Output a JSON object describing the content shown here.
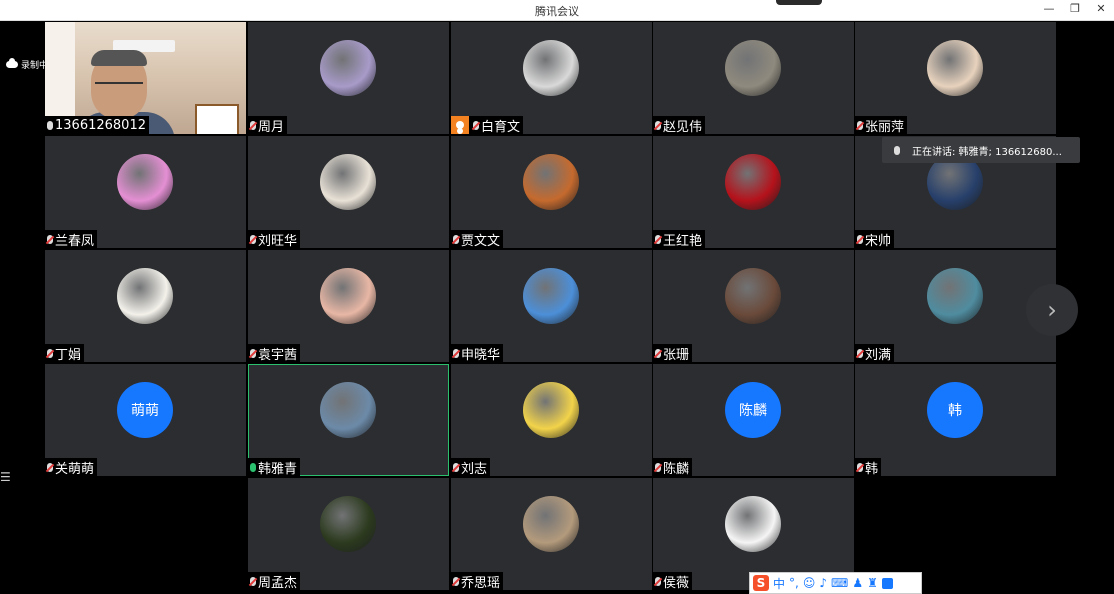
{
  "window": {
    "title": "腾讯会议",
    "controls": {
      "minimize": "—",
      "restore": "❐",
      "close": "✕"
    }
  },
  "recording": {
    "label": "录制中"
  },
  "speaking_tooltip": "正在讲话: 韩雅青; 136612680...",
  "participants": [
    {
      "name": "13661268012",
      "mic": "on",
      "avatar": "camera"
    },
    {
      "name": "周月",
      "mic": "muted",
      "avatar": "photo",
      "color": "#a89bc9"
    },
    {
      "name": "白育文",
      "mic": "muted",
      "avatar": "photo",
      "color": "#d9d9d9",
      "host": true
    },
    {
      "name": "赵见伟",
      "mic": "muted",
      "avatar": "photo",
      "color": "#8f8a7e"
    },
    {
      "name": "张丽萍",
      "mic": "muted",
      "avatar": "photo",
      "color": "#e7d2bd"
    },
    {
      "name": "兰春凤",
      "mic": "muted",
      "avatar": "photo",
      "color": "#e48fd3"
    },
    {
      "name": "刘旺华",
      "mic": "muted",
      "avatar": "photo",
      "color": "#e8e1d6"
    },
    {
      "name": "贾文文",
      "mic": "muted",
      "avatar": "photo",
      "color": "#c56a2e"
    },
    {
      "name": "王红艳",
      "mic": "muted",
      "avatar": "photo",
      "color": "#b5121b"
    },
    {
      "name": "宋帅",
      "mic": "muted",
      "avatar": "photo",
      "color": "#27406b"
    },
    {
      "name": "丁娟",
      "mic": "muted",
      "avatar": "photo",
      "color": "#f3f1ea"
    },
    {
      "name": "袁宇茜",
      "mic": "muted",
      "avatar": "photo",
      "color": "#e8b7a5"
    },
    {
      "name": "申晓华",
      "mic": "muted",
      "avatar": "photo",
      "color": "#4c8fd8"
    },
    {
      "name": "张珊",
      "mic": "muted",
      "avatar": "photo",
      "color": "#6a4a3a"
    },
    {
      "name": "刘满",
      "mic": "muted",
      "avatar": "photo",
      "color": "#4f8c9f"
    },
    {
      "name": "关萌萌",
      "mic": "muted",
      "avatar": "letter",
      "letter": "萌萌"
    },
    {
      "name": "韩雅青",
      "mic": "speaking",
      "avatar": "photo",
      "color": "#6c8aa8"
    },
    {
      "name": "刘志",
      "mic": "muted",
      "avatar": "photo",
      "color": "#f2d34a"
    },
    {
      "name": "陈麟",
      "mic": "muted",
      "avatar": "letter",
      "letter": "陈麟"
    },
    {
      "name": "韩",
      "mic": "muted",
      "avatar": "letter",
      "letter": "韩"
    },
    {
      "name": "周孟杰",
      "mic": "muted",
      "avatar": "photo",
      "color": "#2c3a1e"
    },
    {
      "name": "乔思瑶",
      "mic": "muted",
      "avatar": "photo",
      "color": "#b39a7c"
    },
    {
      "name": "侯薇",
      "mic": "muted",
      "avatar": "photo",
      "color": "#f5f5f5"
    }
  ],
  "next_page": "›",
  "ime": {
    "logo": "S",
    "mode": "中"
  }
}
